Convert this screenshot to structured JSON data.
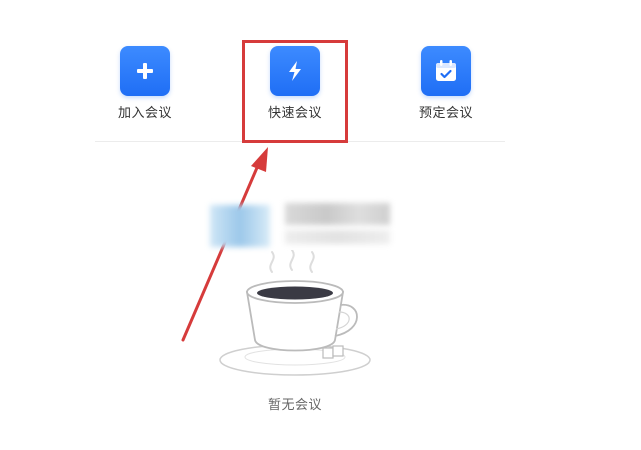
{
  "actions": {
    "join": {
      "label": "加入会议",
      "icon": "plus-icon"
    },
    "quick": {
      "label": "快速会议",
      "icon": "lightning-icon"
    },
    "schedule": {
      "label": "预定会议",
      "icon": "calendar-icon"
    }
  },
  "empty_state": {
    "message": "暂无会议",
    "illustration": "coffee-cup-icon"
  },
  "colors": {
    "accent": "#1f6ef5",
    "annotation": "#d63b3b",
    "divider": "#ececec"
  }
}
